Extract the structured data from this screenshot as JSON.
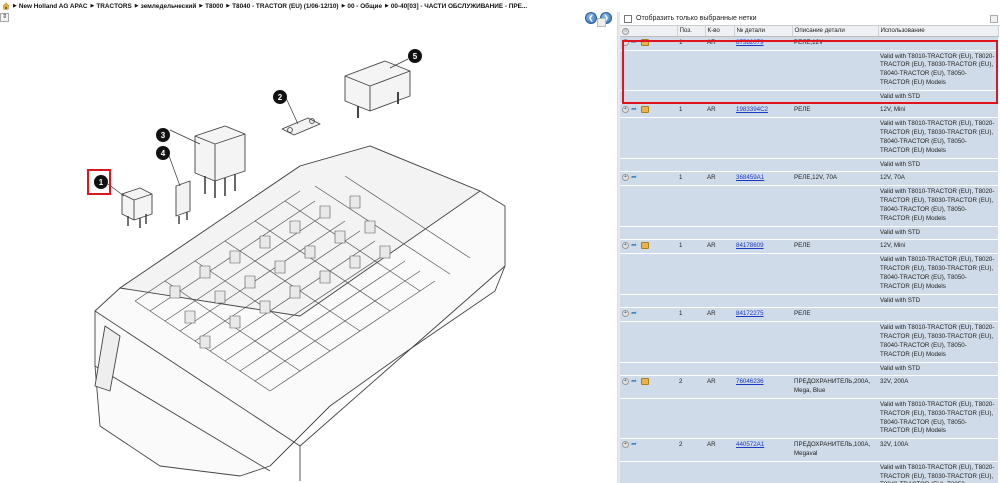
{
  "breadcrumb": [
    "New Holland AG APAC",
    "TRACTORS",
    "земледельческий",
    "T8000",
    "T8040 - TRACTOR (EU) (1/06-12/10)",
    "00 - Общие",
    "00-40[03] - ЧАСТИ ОБСЛУЖИВАНИЕ - ПРЕ..."
  ],
  "filter": {
    "label": "Отобразить только выбранные нетки"
  },
  "columns": {
    "pos": "Поз.",
    "qty": "К-во",
    "part": "№ детали",
    "desc": "Описание детали",
    "usage": "Использование"
  },
  "callouts": [
    "1",
    "2",
    "3",
    "4",
    "5"
  ],
  "rows": [
    {
      "pos": "1",
      "qty": "AR",
      "part": "87582079",
      "desc": "РЕЛЕ,12V",
      "usage": "",
      "valid": "Valid with T8010-TRACTOR (EU), T8020-TRACTOR (EU), T8030-TRACTOR (EU), T8040-TRACTOR (EU), T8050-TRACTOR (EU) Models",
      "std": "Valid with STD",
      "box": true
    },
    {
      "pos": "1",
      "qty": "AR",
      "part": "1983394C2",
      "desc": "РЕЛЕ",
      "usage": "12V, Mini",
      "valid": "Valid with T8010-TRACTOR (EU), T8020-TRACTOR (EU), T8030-TRACTOR (EU), T8040-TRACTOR (EU), T8050-TRACTOR (EU) Models",
      "std": "Valid with STD",
      "box": true
    },
    {
      "pos": "1",
      "qty": "AR",
      "part": "368459A1",
      "desc": "РЕЛЕ,12V, 70A",
      "usage": "12V, 70A",
      "valid": "Valid with T8010-TRACTOR (EU), T8020-TRACTOR (EU), T8030-TRACTOR (EU), T8040-TRACTOR (EU), T8050-TRACTOR (EU) Models",
      "std": "Valid with STD",
      "box": false
    },
    {
      "pos": "1",
      "qty": "AR",
      "part": "84178609",
      "desc": "РЕЛЕ",
      "usage": "12V, Mini",
      "valid": "Valid with T8010-TRACTOR (EU), T8020-TRACTOR (EU), T8030-TRACTOR (EU), T8040-TRACTOR (EU), T8050-TRACTOR (EU) Models",
      "std": "Valid with STD",
      "box": true
    },
    {
      "pos": "1",
      "qty": "AR",
      "part": "84172275",
      "desc": "РЕЛЕ",
      "usage": "",
      "valid": "Valid with T8010-TRACTOR (EU), T8020-TRACTOR (EU), T8030-TRACTOR (EU), T8040-TRACTOR (EU), T8050-TRACTOR (EU) Models",
      "std": "Valid with STD",
      "box": false
    },
    {
      "pos": "2",
      "qty": "AR",
      "part": "76046236",
      "desc": "ПРЕДОХРАНИТЕЛЬ,200A, Mega, Blue",
      "usage": "32V, 200A",
      "valid": "Valid with T8010-TRACTOR (EU), T8020-TRACTOR (EU), T8030-TRACTOR (EU), T8040-TRACTOR (EU), T8050-TRACTOR (EU) Models",
      "std": "",
      "box": true
    },
    {
      "pos": "2",
      "qty": "AR",
      "part": "440572A1",
      "desc": "ПРЕДОХРАНИТЕЛЬ,100A, Megaval",
      "usage": "32V, 100A",
      "valid": "Valid with T8010-TRACTOR (EU), T8020-TRACTOR (EU), T8030-TRACTOR (EU), T8040-TRACTOR (EU), T8050-TRACTOR (EU) Models",
      "std": "",
      "box": false
    }
  ]
}
